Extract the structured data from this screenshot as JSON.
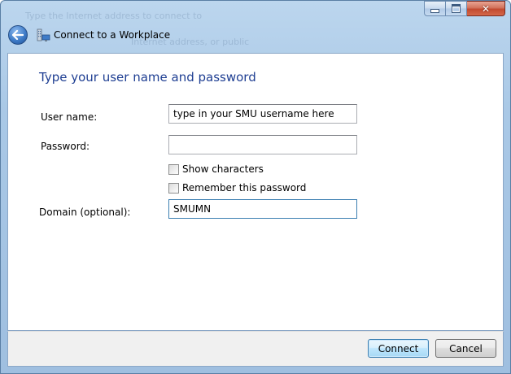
{
  "window": {
    "background_text_1": "Type the Internet address to connect to",
    "background_text_2": "Internet address, or public"
  },
  "nav": {
    "title": "Connect to a Workplace",
    "back_icon": "back-arrow-icon",
    "wizard_icon": "workplace-network-icon"
  },
  "form": {
    "heading": "Type your user name and password",
    "username": {
      "label": "User name:",
      "value": "type in your SMU username here"
    },
    "password": {
      "label": "Password:",
      "value": ""
    },
    "show_characters": {
      "label": "Show characters",
      "checked": false
    },
    "remember_password": {
      "label": "Remember this password",
      "checked": false
    },
    "domain": {
      "label": "Domain (optional):",
      "value": "SMUMN"
    }
  },
  "footer": {
    "connect_label": "Connect",
    "cancel_label": "Cancel"
  },
  "colors": {
    "heading": "#1e3e92",
    "frame": "#a9c8e6",
    "focus_border": "#3c7fb1"
  }
}
